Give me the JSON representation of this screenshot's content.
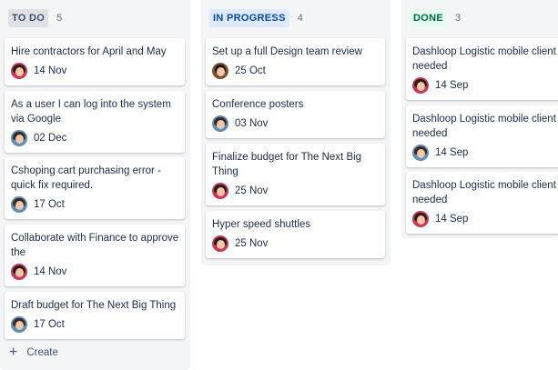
{
  "columns": {
    "todo": {
      "title": "TO DO",
      "count": "5",
      "cards": [
        {
          "title": "Hire contractors for April and May",
          "date": "14 Nov",
          "avatar": "red"
        },
        {
          "title": "As a user I can log into the system via Google",
          "date": "02 Dec",
          "avatar": "blue"
        },
        {
          "title": "Cshoping cart purchasing error - quick fix required.",
          "date": "17 Oct",
          "avatar": "blue"
        },
        {
          "title": "Collaborate with Finance to approve the",
          "date": "14 Nov",
          "avatar": "red"
        },
        {
          "title": "Draft budget for The Next Big Thing",
          "date": "17 Oct",
          "avatar": "blue"
        }
      ],
      "create_label": "Create"
    },
    "inprogress": {
      "title": "IN PROGRESS",
      "count": "4",
      "cards": [
        {
          "title": "Set up a full Design team review",
          "date": "25 Oct",
          "avatar": "brown"
        },
        {
          "title": "Conference posters",
          "date": "03 Nov",
          "avatar": "blue"
        },
        {
          "title": "Finalize budget for The Next Big Thing",
          "date": "25 Nov",
          "avatar": "red"
        },
        {
          "title": "Hyper speed shuttles",
          "date": "25 Nov",
          "avatar": "red"
        }
      ]
    },
    "done": {
      "title": "DONE",
      "count": "3",
      "cards": [
        {
          "title": "Dashloop Logistic mobile client needed",
          "date": "14 Sep",
          "avatar": "red"
        },
        {
          "title": "Dashloop Logistic mobile client needed",
          "date": "14 Sep",
          "avatar": "blue"
        },
        {
          "title": "Dashloop Logistic mobile client needed",
          "date": "14 Sep",
          "avatar": "red"
        }
      ]
    }
  },
  "colors": {
    "column_bg": "#f4f5f7",
    "todo_lozenge": "#dfe1e6",
    "inprogress_lozenge": "#deebff",
    "done_lozenge": "#e3fcef"
  }
}
